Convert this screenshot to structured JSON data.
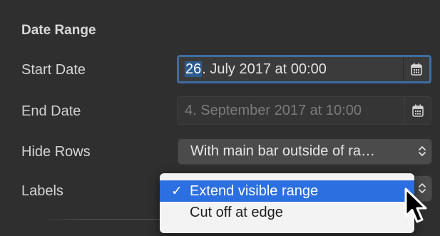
{
  "section": {
    "title": "Date Range"
  },
  "rows": {
    "start_date": {
      "label": "Start Date",
      "value_selected": "26",
      "value_rest": ". July 2017 at 00:00",
      "calendar_icon": "calendar-icon"
    },
    "end_date": {
      "label": "End Date",
      "value": "4. September 2017 at 10:00",
      "calendar_icon": "calendar-icon"
    },
    "hide_rows": {
      "label": "Hide Rows",
      "value": "With main bar outside of ra…"
    },
    "labels": {
      "label": "Labels"
    }
  },
  "labels_menu": {
    "check_mark": "✓",
    "items": [
      {
        "label": "Extend visible range",
        "selected": true
      },
      {
        "label": "Cut off at edge",
        "selected": false
      }
    ]
  },
  "colors": {
    "background": "#2f2f2f",
    "focus_ring": "#3d6da3",
    "menu_highlight": "#2c6fe0",
    "menu_background": "#f3f3f3"
  }
}
